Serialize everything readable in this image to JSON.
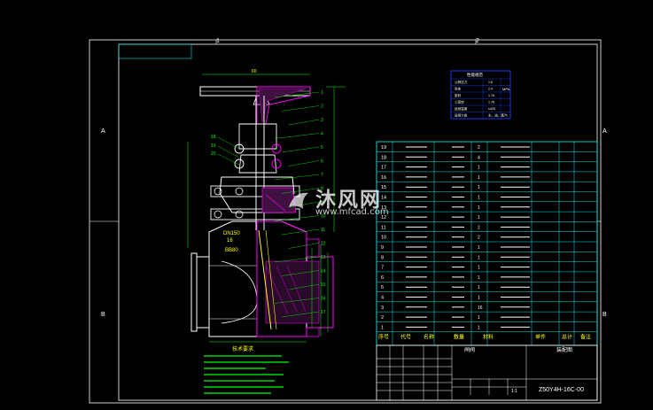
{
  "drawing": {
    "zone_cols": [
      "1",
      "2"
    ],
    "zone_rows": [
      "A",
      "B"
    ],
    "note_heading": "技术要求",
    "dim_top": "60",
    "label_dn": "DN150",
    "label_pn": "16",
    "label_mat": "BB80",
    "leader_left": [
      "18",
      "19",
      "20"
    ],
    "leader_right": [
      "1",
      "2",
      "3",
      "4",
      "5",
      "6",
      "7",
      "8",
      "9",
      "10",
      "11",
      "12",
      "13",
      "14",
      "15",
      "16",
      "17"
    ]
  },
  "perf_table": {
    "title": "性能规范",
    "rows": [
      [
        "公称压力",
        "1.6"
      ],
      [
        "壳体",
        "2.4"
      ],
      [
        "密封",
        "1.76"
      ],
      [
        "上密封",
        "1.76"
      ],
      [
        "适用温度",
        "≤425"
      ],
      [
        "适用介质",
        "水、油、蒸汽"
      ]
    ],
    "unit": "MPa"
  },
  "bom": {
    "rows": [
      [
        "19",
        "",
        "",
        "2",
        "",
        ""
      ],
      [
        "18",
        "",
        "",
        "4",
        "",
        ""
      ],
      [
        "17",
        "",
        "",
        "1",
        "",
        ""
      ],
      [
        "16",
        "",
        "",
        "1",
        "",
        ""
      ],
      [
        "15",
        "",
        "",
        "1",
        "",
        ""
      ],
      [
        "14",
        "",
        "",
        "1",
        "",
        ""
      ],
      [
        "13",
        "",
        "",
        "1",
        "",
        ""
      ],
      [
        "12",
        "",
        "",
        "1",
        "",
        ""
      ],
      [
        "11",
        "",
        "",
        "2",
        "",
        ""
      ],
      [
        "10",
        "",
        "",
        "2",
        "",
        ""
      ],
      [
        "9",
        "",
        "",
        "1",
        "",
        ""
      ],
      [
        "8",
        "",
        "",
        "1",
        "",
        ""
      ],
      [
        "7",
        "",
        "",
        "1",
        "",
        ""
      ],
      [
        "6",
        "",
        "",
        "1",
        "",
        ""
      ],
      [
        "5",
        "",
        "",
        "1",
        "",
        ""
      ],
      [
        "4",
        "",
        "",
        "1",
        "",
        ""
      ],
      [
        "3",
        "",
        "",
        "16",
        "",
        ""
      ],
      [
        "2",
        "",
        "",
        "1",
        "",
        ""
      ],
      [
        "1",
        "",
        "",
        "1",
        "",
        ""
      ]
    ],
    "header": [
      "序号",
      "代号",
      "名称",
      "数量",
      "材料",
      "单件",
      "总计",
      "备注"
    ]
  },
  "title_block": {
    "drawing_name": "闸阀",
    "company": "装配图",
    "drawing_no": "Z50Y4H-16C-00",
    "scale": "1:1"
  },
  "watermark": {
    "title": "沐风网",
    "url": "www.mfcad.com"
  },
  "colors": {
    "background": "#000000",
    "frame": "#ffffff",
    "cyan": "#00e5e5",
    "green": "#00ff00",
    "yellow": "#ffff00",
    "red": "#ff2020",
    "magenta": "#ff00ff",
    "blue": "#2040ff"
  }
}
